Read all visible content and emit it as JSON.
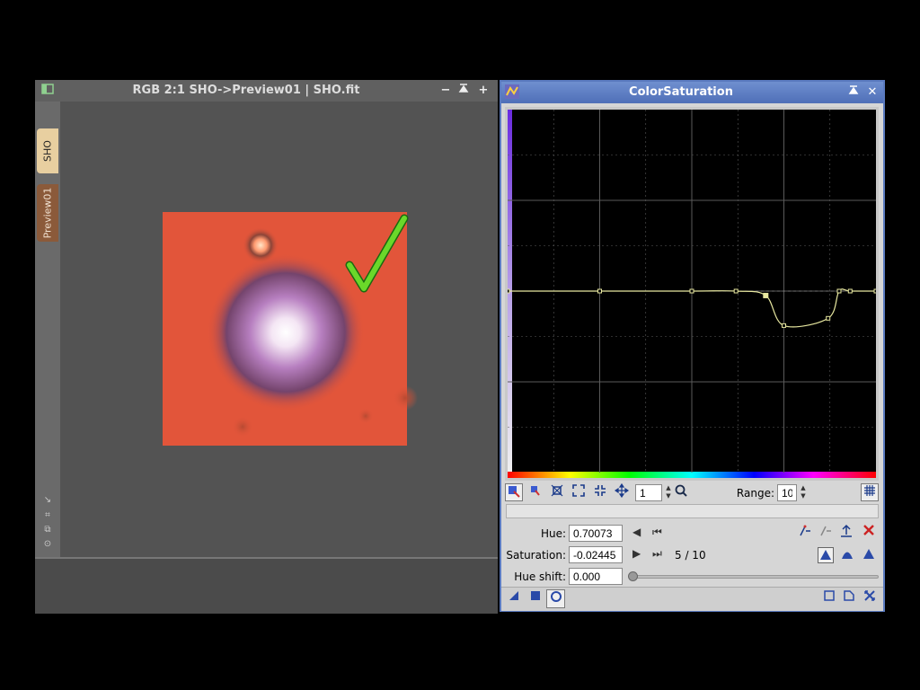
{
  "image_window": {
    "title": "RGB 2:1 SHO->Preview01 | SHO.fit",
    "tabs": [
      {
        "label": "SHO"
      },
      {
        "label": "Preview01"
      }
    ],
    "buttons": {
      "minimize": "−",
      "shade": "⬍",
      "maximize": "+"
    }
  },
  "process_window": {
    "title": "ColorSaturation",
    "close": "✕",
    "shade": "⬍",
    "curve_points": [
      {
        "hue": 0.0,
        "saturation": 0.0
      },
      {
        "hue": 0.25,
        "saturation": 0.0
      },
      {
        "hue": 0.5,
        "saturation": 0.0
      },
      {
        "hue": 0.62,
        "saturation": 0.0
      },
      {
        "hue": 0.70073,
        "saturation": -0.02445
      },
      {
        "hue": 0.75,
        "saturation": -0.19
      },
      {
        "hue": 0.87,
        "saturation": -0.15
      },
      {
        "hue": 0.9,
        "saturation": 0.0
      },
      {
        "hue": 0.93,
        "saturation": 0.0
      },
      {
        "hue": 1.0,
        "saturation": 0.0
      }
    ],
    "toolbar": {
      "zoom_value": "1",
      "range_label": "Range:",
      "range_value": "10"
    },
    "fields": {
      "hue_label": "Hue:",
      "hue_value": "0.70073",
      "saturation_label": "Saturation:",
      "saturation_value": "-0.02445",
      "hue_shift_label": "Hue shift:",
      "hue_shift_value": "0.000",
      "point_counter": "5 / 10"
    },
    "colors": {
      "curve": "#e8e8a0",
      "graph_bg": "#000000",
      "grid": "#5a5a5a",
      "delete": "#cc2222"
    }
  }
}
